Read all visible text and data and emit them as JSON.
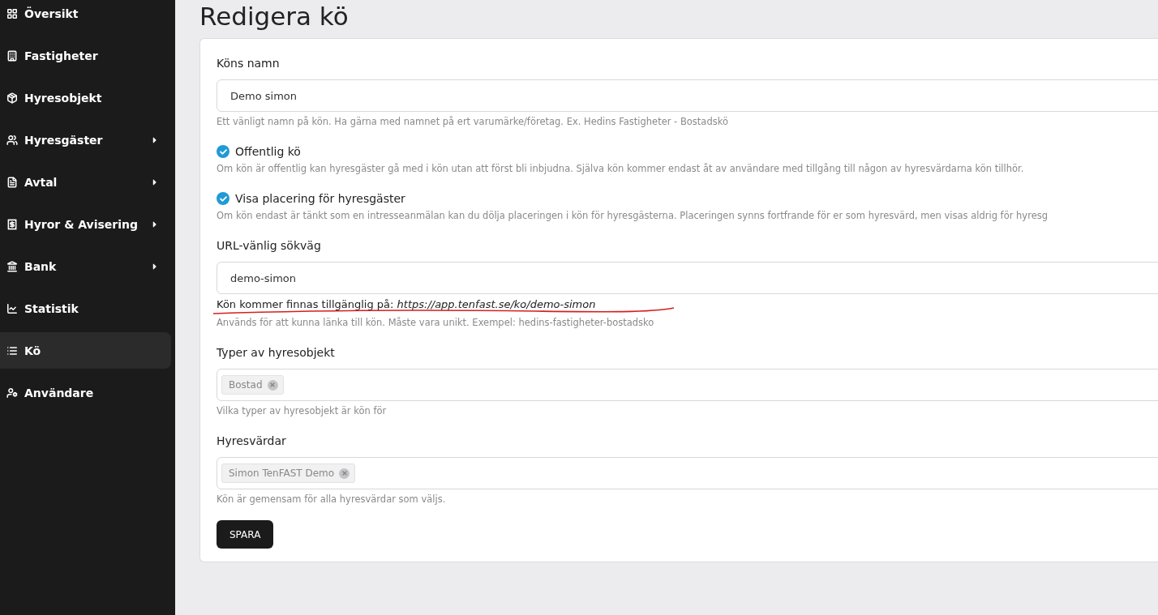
{
  "sidebar": {
    "items": [
      {
        "label": "Översikt",
        "selected": false,
        "expandable": false
      },
      {
        "label": "Fastigheter",
        "selected": false,
        "expandable": false
      },
      {
        "label": "Hyresobjekt",
        "selected": false,
        "expandable": false
      },
      {
        "label": "Hyresgäster",
        "selected": false,
        "expandable": true
      },
      {
        "label": "Avtal",
        "selected": false,
        "expandable": true
      },
      {
        "label": "Hyror & Avisering",
        "selected": false,
        "expandable": true
      },
      {
        "label": "Bank",
        "selected": false,
        "expandable": true
      },
      {
        "label": "Statistik",
        "selected": false,
        "expandable": false
      },
      {
        "label": "Kö",
        "selected": true,
        "expandable": false
      },
      {
        "label": "Användare",
        "selected": false,
        "expandable": false
      }
    ]
  },
  "page": {
    "title": "Redigera kö"
  },
  "form": {
    "fields": [
      {
        "kind": "text",
        "label": "Köns namn",
        "value": "Demo simon",
        "help": "Ett vänligt namn på kön. Ha gärna med namnet på ert varumärke/företag. Ex. Hedins Fastigheter - Bostadskö"
      },
      {
        "kind": "checkbox",
        "label": "Offentlig kö",
        "checked": true,
        "help": "Om kön är offentlig kan hyresgäster gå med i kön utan att först bli inbjudna. Själva kön kommer endast åt av användare med tillgång till någon av hyresvärdarna kön tillhör."
      },
      {
        "kind": "checkbox",
        "label": "Visa placering för hyresgäster",
        "checked": true,
        "help": "Om kön endast är tänkt som en intresseanmälan kan du dölja placeringen i kön för hyresgästerna. Placeringen synns fortfrande för er som hyresvärd, men visas aldrig för hyresg"
      },
      {
        "kind": "text",
        "label": "URL-vänlig sökväg",
        "value": "demo-simon",
        "note": "Kön kommer finnas tillgänglig på: *https://app.tenfast.se/ko/demo-simon*",
        "help": "Används för att kunna länka till kön. Måste vara unikt. Exempel: hedins-fastigheter-bostadsko"
      },
      {
        "kind": "tags",
        "label": "Typer av hyresobjekt",
        "tags": [
          "Bostad"
        ],
        "help": "Vilka typer av hyresobjekt är kön för"
      },
      {
        "kind": "tags",
        "label": "Hyresvärdar",
        "tags": [
          "Simon TenFAST Demo"
        ],
        "help": "Kön är gemensam för alla hyresvärdar som väljs."
      }
    ],
    "submit": "SPARA"
  }
}
